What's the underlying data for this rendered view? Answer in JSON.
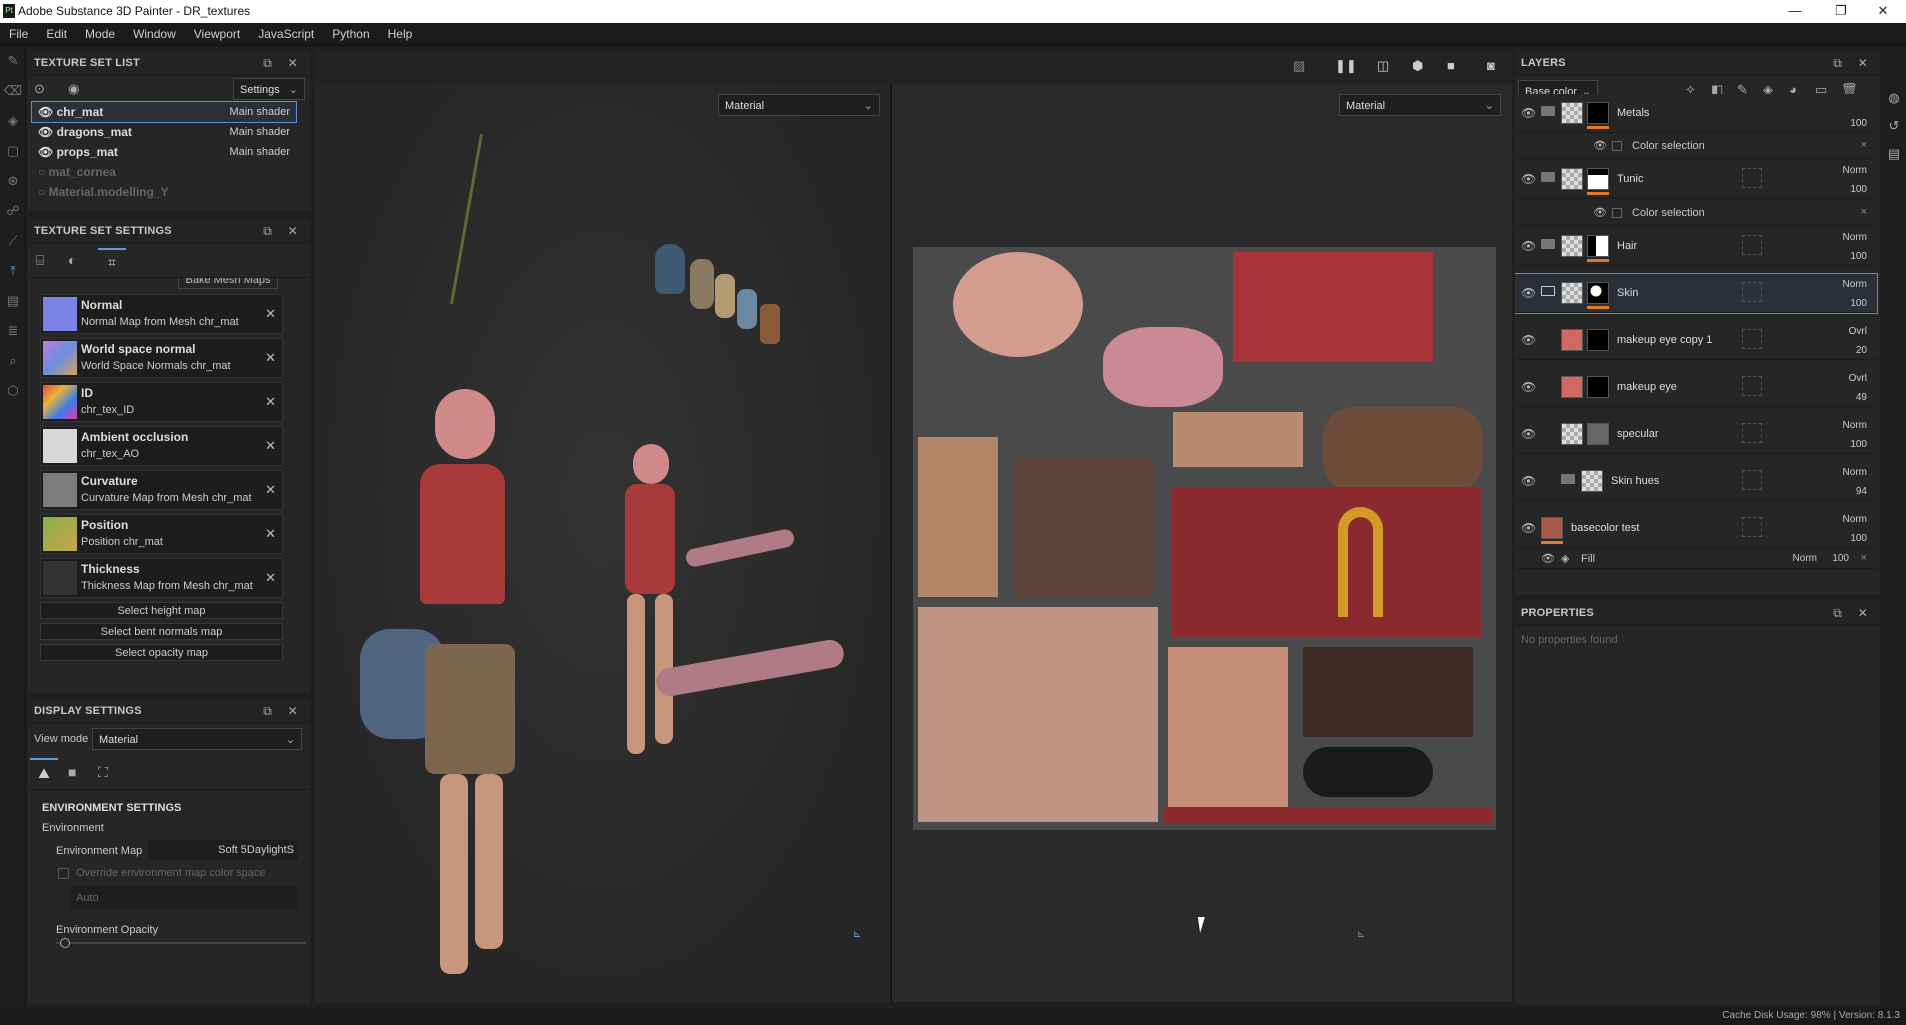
{
  "window": {
    "title": "Adobe Substance 3D Painter - DR_textures",
    "minimize": "—",
    "maximize": "❐",
    "close": "✕"
  },
  "menu": [
    "File",
    "Edit",
    "Mode",
    "Window",
    "Viewport",
    "JavaScript",
    "Python",
    "Help"
  ],
  "texture_set_list": {
    "title": "TEXTURE SET LIST",
    "settings_label": "Settings",
    "items": [
      {
        "name": "chr_mat",
        "shader": "Main shader"
      },
      {
        "name": "dragons_mat",
        "shader": "Main shader"
      },
      {
        "name": "props_mat",
        "shader": "Main shader"
      },
      {
        "name": "mat_cornea",
        "shader": ""
      },
      {
        "name": "Material.modelling_Y",
        "shader": ""
      }
    ]
  },
  "texture_set_settings": {
    "title": "TEXTURE SET SETTINGS",
    "bake_label": "Bake Mesh Maps",
    "maps": [
      {
        "name": "Normal",
        "source": "Normal Map from Mesh chr_mat",
        "color": "#7b83e6"
      },
      {
        "name": "World space normal",
        "source": "World Space Normals chr_mat",
        "color": "#9a7ad0"
      },
      {
        "name": "ID",
        "source": "chr_tex_ID",
        "color": "#e8b33a"
      },
      {
        "name": "Ambient occlusion",
        "source": "chr_tex_AO",
        "color": "#d8d8d8"
      },
      {
        "name": "Curvature",
        "source": "Curvature Map from Mesh chr_mat",
        "color": "#7d7d7d"
      },
      {
        "name": "Position",
        "source": "Position chr_mat",
        "color": "#86b34a"
      },
      {
        "name": "Thickness",
        "source": "Thickness Map from Mesh chr_mat",
        "color": "#333333"
      }
    ],
    "buttons": [
      "Select height map",
      "Select bent normals map",
      "Select opacity map"
    ]
  },
  "display_settings": {
    "title": "DISPLAY SETTINGS",
    "view_mode_label": "View mode",
    "view_mode": "Material",
    "env_heading": "ENVIRONMENT SETTINGS",
    "env_label": "Environment",
    "env_map_label": "Environment Map",
    "env_map_value": "Soft 5DaylightS",
    "override_label": "Override environment map color space",
    "auto_label": "Auto",
    "opacity_label": "Environment Opacity"
  },
  "viewport": {
    "left_mode": "Material",
    "right_mode": "Material"
  },
  "layers": {
    "title": "LAYERS",
    "channel": "Base color",
    "rows": [
      {
        "type": "layer",
        "name": "Metals",
        "blend": "",
        "opacity": "100",
        "mask": "black"
      },
      {
        "type": "effect",
        "name": "Color selection"
      },
      {
        "type": "layer",
        "name": "Tunic",
        "blend": "Norm",
        "opacity": "100",
        "mask": "white"
      },
      {
        "type": "effect",
        "name": "Color selection"
      },
      {
        "type": "layer",
        "name": "Hair",
        "blend": "Norm",
        "opacity": "100",
        "mask": "white"
      },
      {
        "type": "layer",
        "name": "Skin",
        "blend": "Norm",
        "opacity": "100",
        "mask": "white",
        "selected": true
      },
      {
        "type": "layer",
        "name": "makeup eye copy 1",
        "blend": "Ovrl",
        "opacity": "20",
        "mask": "black"
      },
      {
        "type": "layer",
        "name": "makeup eye",
        "blend": "Ovrl",
        "opacity": "49",
        "mask": "black"
      },
      {
        "type": "layer",
        "name": "specular",
        "blend": "Norm",
        "opacity": "100",
        "mask": "grey"
      },
      {
        "type": "layer",
        "name": "Skin hues",
        "blend": "Norm",
        "opacity": "94",
        "mask": ""
      },
      {
        "type": "layer",
        "name": "basecolor test",
        "blend": "Norm",
        "opacity": "100",
        "mask": ""
      }
    ],
    "fill_row": {
      "name": "Fill",
      "blend": "Norm",
      "opacity": "100"
    }
  },
  "properties": {
    "title": "PROPERTIES",
    "empty": "No properties found"
  },
  "status": {
    "text": "Cache Disk Usage:  98%  |  Version: 8.1.3"
  }
}
